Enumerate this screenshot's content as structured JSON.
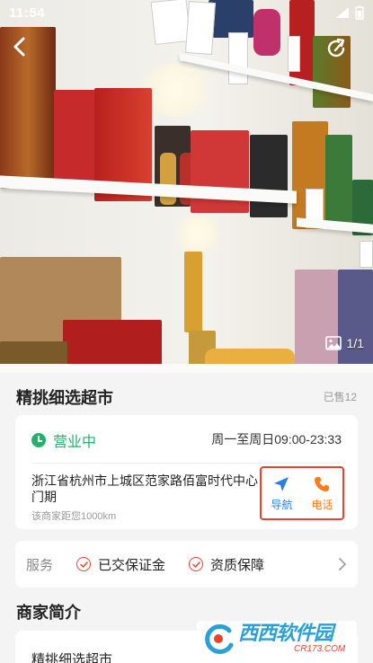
{
  "status_bar": {
    "time": "11:54"
  },
  "hero": {
    "image_counter": "1/1"
  },
  "shop": {
    "name": "精挑细选超市",
    "sold": "已售12"
  },
  "info": {
    "status": "营业中",
    "hours": "周一至周日09:00-23:33",
    "address": "浙江省杭州市上城区范家路佰富时代中心门期",
    "distance": "该商家距您1000km",
    "navigate_label": "导航",
    "call_label": "电话"
  },
  "service": {
    "title": "服务",
    "items": [
      "已交保证金",
      "资质保障"
    ]
  },
  "intro": {
    "title": "商家简介",
    "text": "精挑细选超市"
  },
  "watermark": {
    "main": "西西软件园",
    "sub": "CR173.COM"
  },
  "colors": {
    "green": "#1fb36b",
    "red_highlight": "#e8432e",
    "nav_blue": "#2a7fe0",
    "call_orange": "#ff7a1a"
  }
}
